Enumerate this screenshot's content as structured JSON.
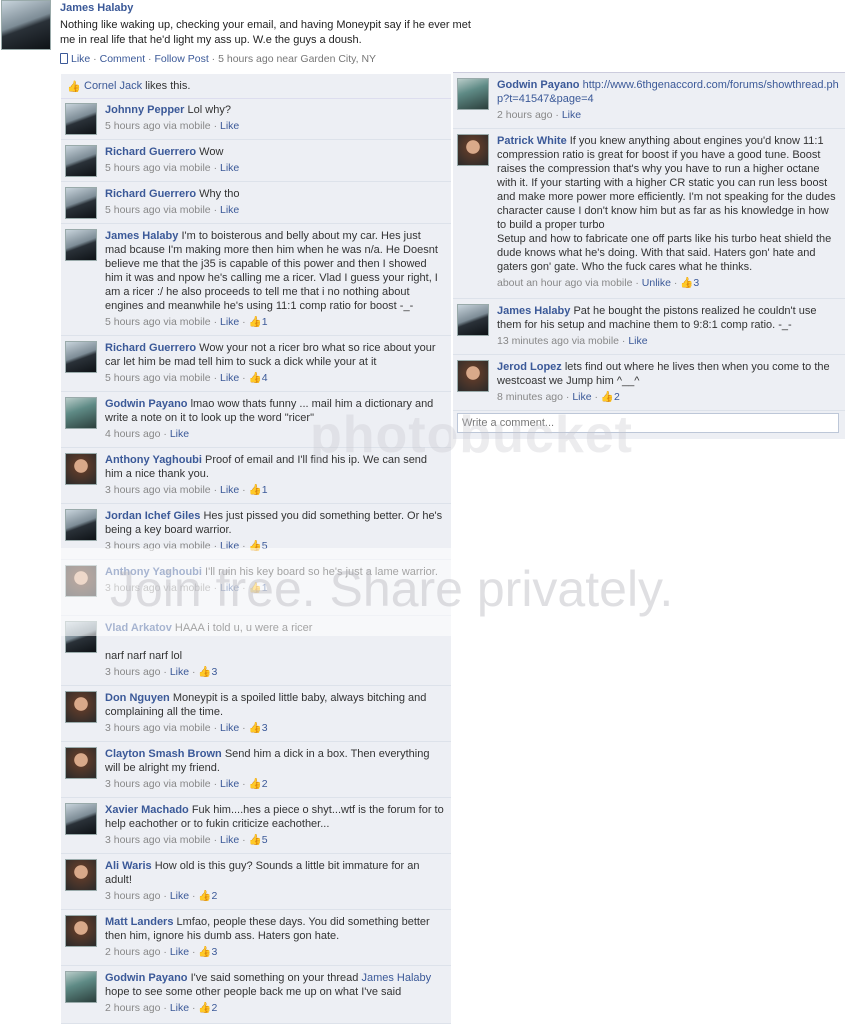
{
  "post": {
    "author": "James Halaby",
    "text": "Nothing like waking up, checking your email, and having Moneypit say if he ever met me in real life that he'd light my ass up. W.e the guys a doush.",
    "like": "Like",
    "comment": "Comment",
    "follow": "Follow Post",
    "time": "5 hours ago near Garden City, NY"
  },
  "likes_line": {
    "name": "Cornel Jack",
    "text": "likes this."
  },
  "left_comments": [
    {
      "author": "Johnny Pepper",
      "text": "Lol why?",
      "meta": "5 hours ago via mobile",
      "like": "Like",
      "count": ""
    },
    {
      "author": "Richard Guerrero",
      "text": "Wow",
      "meta": "5 hours ago via mobile",
      "like": "Like",
      "count": ""
    },
    {
      "author": "Richard Guerrero",
      "text": "Why tho",
      "meta": "5 hours ago via mobile",
      "like": "Like",
      "count": ""
    },
    {
      "author": "James Halaby",
      "text": "I'm to boisterous and belly about my car. Hes just mad bcause I'm making more then him when he was n/a. He Doesnt believe me that the j35 is capable of this power and then I showed him it was and npow he's calling me a ricer. Vlad I guess your right, I am a ricer :/ he also proceeds to tell me that i no nothing about engines and meanwhile he's using 11:1 comp ratio for boost -_-",
      "meta": "5 hours ago via mobile",
      "like": "Like",
      "count": "1"
    },
    {
      "author": "Richard Guerrero",
      "text": "Wow your not a ricer bro what so rice about your car let him be mad tell him to suck a dick while your at it",
      "meta": "5 hours ago via mobile",
      "like": "Like",
      "count": "4"
    },
    {
      "author": "Godwin Payano",
      "text": "lmao wow thats funny ... mail him a dictionary and write a note on it to look up the word \"ricer\"",
      "meta": "4 hours ago",
      "like": "Like",
      "count": ""
    },
    {
      "author": "Anthony Yaghoubi",
      "text": "Proof of email and I'll find his ip. We can send him a nice thank you.",
      "meta": "3 hours ago via mobile",
      "like": "Like",
      "count": "1"
    },
    {
      "author": "Jordan Ichef Giles",
      "text": "Hes just pissed you did something better. Or he's being a key board warrior.",
      "meta": "3 hours ago via mobile",
      "like": "Like",
      "count": "5"
    },
    {
      "author": "Anthony Yaghoubi",
      "text": "I'll ruin his key board so he's just a lame warrior.",
      "meta": "3 hours ago via mobile",
      "like": "Like",
      "count": "1"
    },
    {
      "author": "Vlad Arkatov",
      "text": "HAAA i told u, u were a ricer\n\nnarf narf narf lol",
      "meta": "3 hours ago",
      "like": "Like",
      "count": "3"
    },
    {
      "author": "Don Nguyen",
      "text": "Moneypit is a spoiled little baby, always bitching and complaining all the time.",
      "meta": "3 hours ago via mobile",
      "like": "Like",
      "count": "3"
    },
    {
      "author": "Clayton Smash Brown",
      "text": "Send him a dick in a box. Then everything will be alright my friend.",
      "meta": "3 hours ago via mobile",
      "like": "Like",
      "count": "2"
    },
    {
      "author": "Xavier Machado",
      "text": "Fuk him....hes a piece o shyt...wtf is the forum for to help eachother or to fukin criticize eachother...",
      "meta": "3 hours ago via mobile",
      "like": "Like",
      "count": "5"
    },
    {
      "author": "Ali Waris",
      "text": "How old is this guy? Sounds a little bit immature for an adult!",
      "meta": "3 hours ago",
      "like": "Like",
      "count": "2"
    },
    {
      "author": "Matt Landers",
      "text": "Lmfao, people these days. You did something better then him, ignore his dumb ass. Haters gon hate.",
      "meta": "2 hours ago",
      "like": "Like",
      "count": "3"
    },
    {
      "author": "Godwin Payano",
      "text": "I've said something on your thread",
      "mention": "James Halaby",
      "text2": "hope to see some other people back me up on what I've said",
      "meta": "2 hours ago",
      "like": "Like",
      "count": "2"
    }
  ],
  "right_comments": [
    {
      "author": "Godwin Payano",
      "link": "http://www.6thgenaccord.com/forums/showthread.php?t=41547&page=4",
      "meta": "2 hours ago",
      "like": "Like",
      "count": ""
    },
    {
      "author": "Patrick White",
      "text": "If you knew anything about engines you'd know 11:1 compression ratio is great for boost if you have a good tune. Boost raises the compression that's why you have to run a higher octane with it. If your starting with a higher CR static you can run less boost and make more power more efficiently. I'm not speaking for the dudes character cause I don't know him but as far as his knowledge in how to build a proper turbo\nSetup and how to fabricate one off parts like his turbo heat shield the dude knows what he's doing. With that said. Haters gon' hate and gaters gon' gate. Who the fuck cares what he thinks.",
      "meta": "about an hour ago via mobile",
      "like": "Unlike",
      "count": "3"
    },
    {
      "author": "James Halaby",
      "text": "Pat he bought the pistons realized he couldn't use them for his setup and machine them to 9:8:1 comp ratio. -_-",
      "meta": "13 minutes ago via mobile",
      "like": "Like",
      "count": ""
    },
    {
      "author": "Jerod Lopez",
      "text": "lets find out where he lives then when you come to the westcoast we Jump him ^__^",
      "meta": "8 minutes ago",
      "like": "Like",
      "count": "2"
    }
  ],
  "write_placeholder": "Write a comment...",
  "watermark": {
    "logo": "photobucket",
    "slogan": "Join free. Share privately."
  }
}
